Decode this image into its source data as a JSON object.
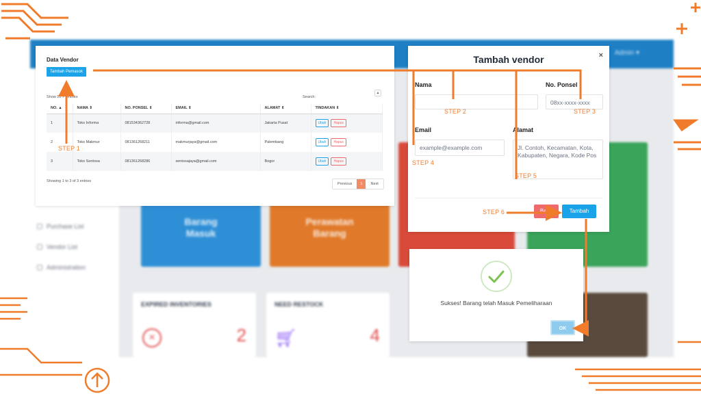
{
  "background": {
    "user_menu": "Admin ▾",
    "sidebar_items": [
      "Purchase List",
      "Vendor List",
      "Administration"
    ],
    "cards": [
      "Barang\nMasuk",
      "Perawatan\nBarang"
    ],
    "stats": [
      {
        "title": "EXPIRED INVENTORIES",
        "value": "2"
      },
      {
        "title": "NEED RESTOCK",
        "value": "4"
      }
    ]
  },
  "vendor_panel": {
    "title": "Data Vendor",
    "add_button": "Tambah Pemasok",
    "show_entries": "Show 10 ✓ entries",
    "search_label": "Search:",
    "sort_icon": "▲",
    "columns": [
      "NO. ▲",
      "NAMA ⇕",
      "NO. PONSEL ⇕",
      "EMAIL ⇕",
      "ALAMAT ⇕",
      "TINDAKAN ⇕"
    ],
    "rows": [
      {
        "no": "1",
        "nama": "Toko Informa",
        "ponsel": "081534362728",
        "email": "informa@gmail.com",
        "alamat": "Jakarta Pusat"
      },
      {
        "no": "2",
        "nama": "Toko Makmur",
        "ponsel": "081361268211",
        "email": "makmurjaya@gmail.com",
        "alamat": "Palembang"
      },
      {
        "no": "3",
        "nama": "Toko Sentosa",
        "ponsel": "081361268286",
        "email": "sentosajaya@gmail.com",
        "alamat": "Bogor"
      }
    ],
    "ubah_label": "Ubah",
    "hapus_label": "Hapus",
    "info": "Showing 1 to 3 of 3 entries",
    "pager": {
      "previous": "Previous",
      "current": "1",
      "next": "Next"
    }
  },
  "modal": {
    "title": "Tambah vendor",
    "close": "×",
    "nama_label": "Nama",
    "ponsel_label": "No. Ponsel",
    "ponsel_placeholder": "08xx-xxxx-xxxx",
    "email_label": "Email",
    "email_placeholder": "example@example.com",
    "alamat_label": "Alamat",
    "alamat_placeholder": "Jl. Contoh, Kecamatan, Kota, Kabupaten, Negara, Kode Pos",
    "batal_button": "Batal",
    "tambah_button": "Tambah"
  },
  "success_dialog": {
    "message": "Sukses! Barang telah Masuk Pemeliharaan",
    "ok_button": "OK"
  },
  "steps": [
    "STEP 1",
    "STEP 2",
    "STEP 3",
    "STEP 4",
    "STEP 5",
    "STEP 6"
  ],
  "colors": {
    "accent": "#f07c2b",
    "primary": "#1aa3e8",
    "danger": "#ef6b6b",
    "success": "#5cb85c"
  }
}
